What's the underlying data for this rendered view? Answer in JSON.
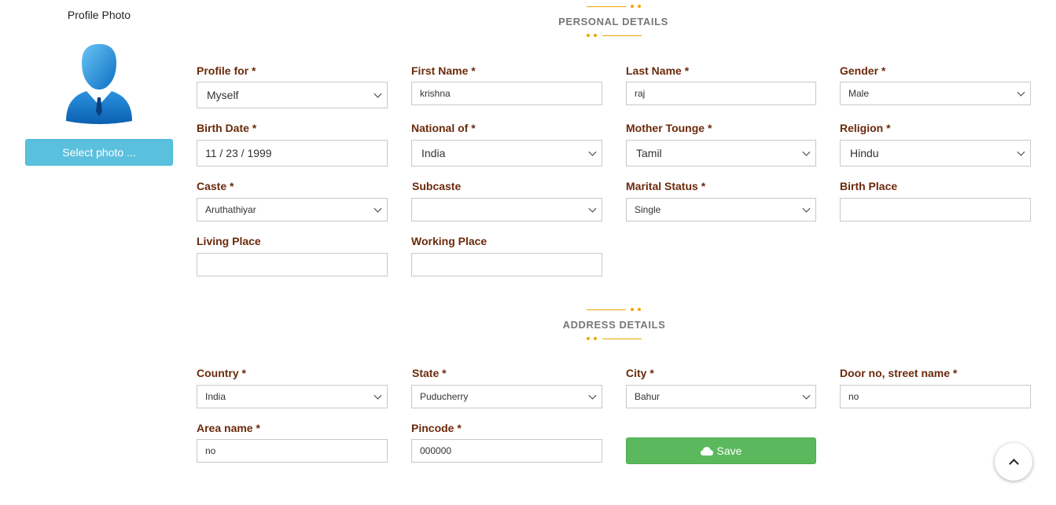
{
  "sidebar": {
    "photo_label": "Profile Photo",
    "select_photo_label": "Select photo ..."
  },
  "personal": {
    "title": "PERSONAL DETAILS",
    "fields": {
      "profile_for": {
        "label": "Profile for *",
        "value": "Myself"
      },
      "first_name": {
        "label": "First Name *",
        "value": "krishna"
      },
      "last_name": {
        "label": "Last Name *",
        "value": "raj"
      },
      "gender": {
        "label": "Gender *",
        "value": "Male"
      },
      "birth_date": {
        "label": "Birth Date *",
        "value": "11 / 23 / 1999"
      },
      "national_of": {
        "label": "National of *",
        "value": "India"
      },
      "mother_tounge": {
        "label": "Mother Tounge *",
        "value": "Tamil"
      },
      "religion": {
        "label": "Religion *",
        "value": "Hindu"
      },
      "caste": {
        "label": "Caste *",
        "value": "Aruthathiyar"
      },
      "subcaste": {
        "label": "Subcaste",
        "value": ""
      },
      "marital_status": {
        "label": "Marital Status *",
        "value": "Single"
      },
      "birth_place": {
        "label": "Birth Place",
        "value": ""
      },
      "living_place": {
        "label": "Living Place",
        "value": ""
      },
      "working_place": {
        "label": "Working Place",
        "value": ""
      }
    }
  },
  "address": {
    "title": "ADDRESS DETAILS",
    "fields": {
      "country": {
        "label": "Country *",
        "value": "India"
      },
      "state": {
        "label": "State *",
        "value": "Puducherry"
      },
      "city": {
        "label": "City *",
        "value": "Bahur"
      },
      "door_street": {
        "label": "Door no, street name *",
        "value": "no"
      },
      "area_name": {
        "label": "Area name *",
        "value": "no"
      },
      "pincode": {
        "label": "Pincode *",
        "value": "000000"
      }
    },
    "save_label": "Save"
  },
  "colors": {
    "label": "#6b2a0b",
    "accent_orange": "#f0a500",
    "info_button": "#5bc0de",
    "success_button": "#5cb85c"
  }
}
